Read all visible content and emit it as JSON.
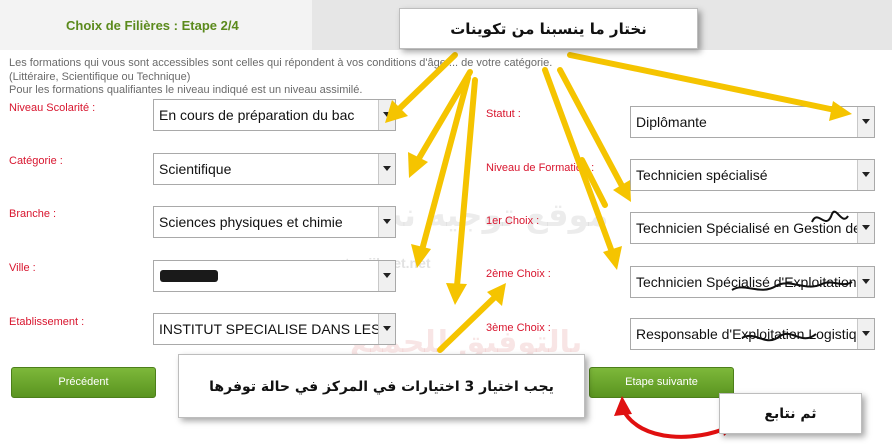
{
  "header": {
    "title": "Choix de Filières : Etape 2/4"
  },
  "intro": {
    "line1": "Les formations qui vous sont accessibles sont celles qui répondent à vos conditions d'âge ... de votre catégorie.",
    "line2": "(Littéraire, Scientifique ou Technique)",
    "line3": "Pour les formations qualifiantes le niveau indiqué est un niveau assimilé."
  },
  "left_fields": [
    {
      "label": "Niveau Scolarité :",
      "value": "En cours de préparation du bac"
    },
    {
      "label": "Catégorie :",
      "value": "Scientifique"
    },
    {
      "label": "Branche :",
      "value": "Sciences physiques et chimie"
    },
    {
      "label": "Ville :",
      "value": ""
    },
    {
      "label": "Etablissement :",
      "value": "INSTITUT SPECIALISE DANS LES"
    }
  ],
  "right_fields": [
    {
      "label": "Statut :",
      "value": "Diplômante"
    },
    {
      "label": "Niveau de Formation :",
      "value": "Technicien spécialisé"
    },
    {
      "label": "1er Choix :",
      "value": "Technicien Spécialisé en Gestion des"
    },
    {
      "label": "2ème Choix :",
      "value": "Technicien Spécialisé d'Exploitation d"
    },
    {
      "label": "3ème Choix :",
      "value": "Responsable d'Exploitation Logistique"
    }
  ],
  "buttons": {
    "previous": "Précédent",
    "next": "Etape suivante"
  },
  "callouts": {
    "top": "نختار ما ينسبنا من تكوينات",
    "bottom": "يجب اختيار 3 اختيارات في المركز في حالة توفرها",
    "right": "ثم نتابع"
  },
  "watermark": {
    "line1": "موقع توجيه نت",
    "line2": "بالتوفيق للجميع",
    "url": "tawjihnet.net"
  },
  "colors": {
    "title": "#5b8a1c",
    "label": "#d8152e",
    "button": "#6aa52a",
    "arrow": "#f5c400",
    "red_arrow": "#e01010"
  }
}
